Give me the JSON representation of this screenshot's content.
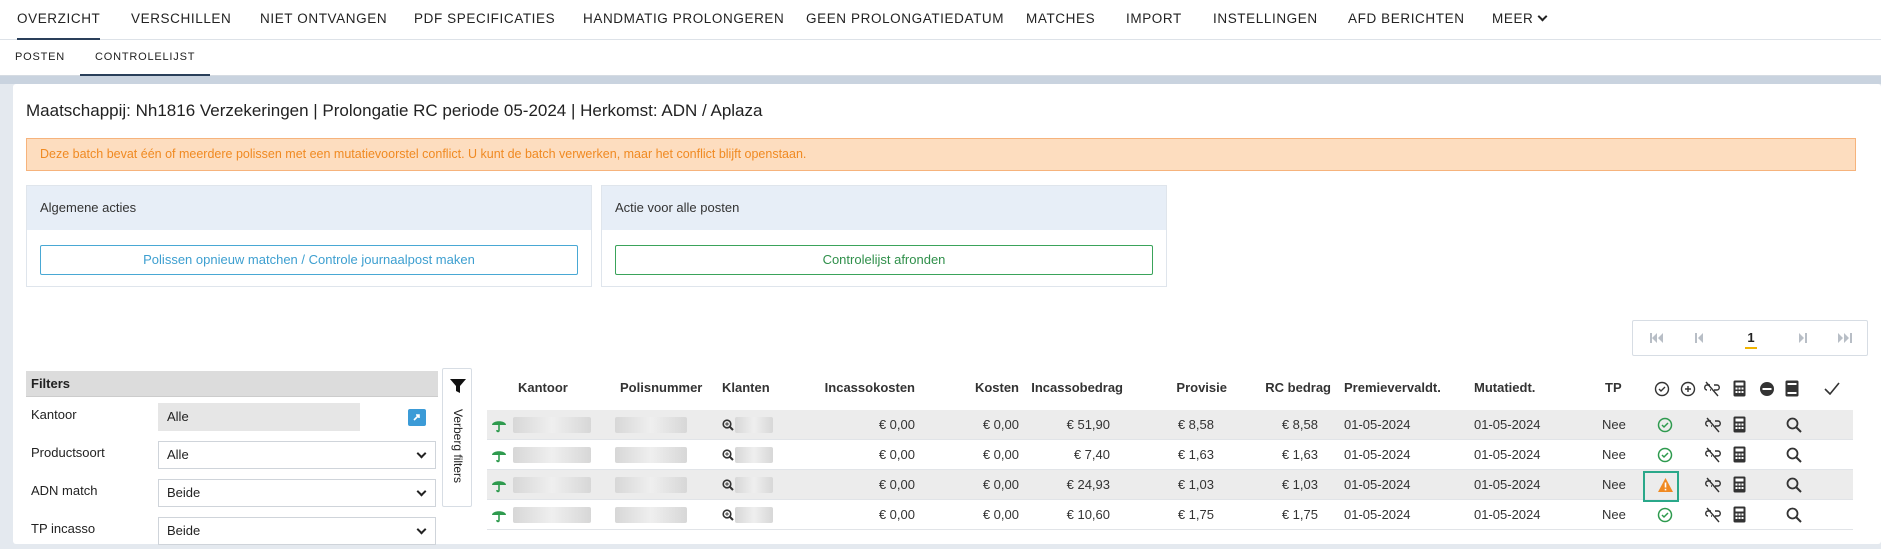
{
  "topnav": {
    "tabs": [
      {
        "label": "OVERZICHT",
        "active": true
      },
      {
        "label": "VERSCHILLEN"
      },
      {
        "label": "NIET ONTVANGEN"
      },
      {
        "label": "PDF SPECIFICATIES"
      },
      {
        "label": "HANDMATIG PROLONGEREN"
      },
      {
        "label": "GEEN PROLONGATIEDATUM"
      },
      {
        "label": "MATCHES"
      },
      {
        "label": "IMPORT"
      },
      {
        "label": "INSTELLINGEN"
      },
      {
        "label": "AFD BERICHTEN"
      },
      {
        "label": "MEER"
      }
    ]
  },
  "subnav": {
    "tabs": [
      {
        "label": "POSTEN"
      },
      {
        "label": "CONTROLELIJST",
        "active": true
      }
    ]
  },
  "title": "Maatschappij: Nh1816 Verzekeringen | Prolongatie RC periode 05-2024 | Herkomst: ADN / Aplaza",
  "alert": "Deze batch bevat één of meerdere polissen met een mutatievoorstel conflict. U kunt de batch verwerken, maar het conflict blijft openstaan.",
  "panels": {
    "general": {
      "title": "Algemene acties",
      "button": "Polissen opnieuw matchen / Controle journaalpost maken"
    },
    "all_items": {
      "title": "Actie voor alle posten",
      "button": "Controlelijst afronden"
    }
  },
  "pager": {
    "current": "1"
  },
  "filters": {
    "title": "Filters",
    "toggle_label": "Verberg filters",
    "rows": [
      {
        "label": "Kantoor",
        "value": "Alle"
      },
      {
        "label": "Productsoort",
        "value": "Alle"
      },
      {
        "label": "ADN match",
        "value": "Beide"
      },
      {
        "label": "TP incasso",
        "value": "Beide"
      }
    ]
  },
  "table": {
    "headers": {
      "kantoor": "Kantoor",
      "polisnummer": "Polisnummer",
      "klanten": "Klanten",
      "incassokosten": "Incassokosten",
      "kosten": "Kosten",
      "incassobedrag": "Incassobedrag",
      "provisie": "Provisie",
      "rc_bedrag": "RC bedrag",
      "premievervaldt": "Premievervaldt.",
      "mutatiedt": "Mutatiedt.",
      "tp": "TP"
    },
    "rows": [
      {
        "incassokosten": "€ 0,00",
        "kosten": "€ 0,00",
        "incassobedrag": "€ 51,90",
        "provisie": "€ 8,58",
        "rc_bedrag": "€ 8,58",
        "premievervaldt": "01-05-2024",
        "mutatiedt": "01-05-2024",
        "tp": "Nee",
        "status": "ok"
      },
      {
        "incassokosten": "€ 0,00",
        "kosten": "€ 0,00",
        "incassobedrag": "€ 7,40",
        "provisie": "€ 1,63",
        "rc_bedrag": "€ 1,63",
        "premievervaldt": "01-05-2024",
        "mutatiedt": "01-05-2024",
        "tp": "Nee",
        "status": "ok"
      },
      {
        "incassokosten": "€ 0,00",
        "kosten": "€ 0,00",
        "incassobedrag": "€ 24,93",
        "provisie": "€ 1,03",
        "rc_bedrag": "€ 1,03",
        "premievervaldt": "01-05-2024",
        "mutatiedt": "01-05-2024",
        "tp": "Nee",
        "status": "warning"
      },
      {
        "incassokosten": "€ 0,00",
        "kosten": "€ 0,00",
        "incassobedrag": "€ 10,60",
        "provisie": "€ 1,75",
        "rc_bedrag": "€ 1,75",
        "premievervaldt": "01-05-2024",
        "mutatiedt": "01-05-2024",
        "tp": "Nee",
        "status": "ok"
      }
    ]
  },
  "colors": {
    "accent": "#2a3f5a",
    "warning": "#f08a22",
    "ok": "#2e9a4e",
    "blue": "#3d9fd0"
  }
}
